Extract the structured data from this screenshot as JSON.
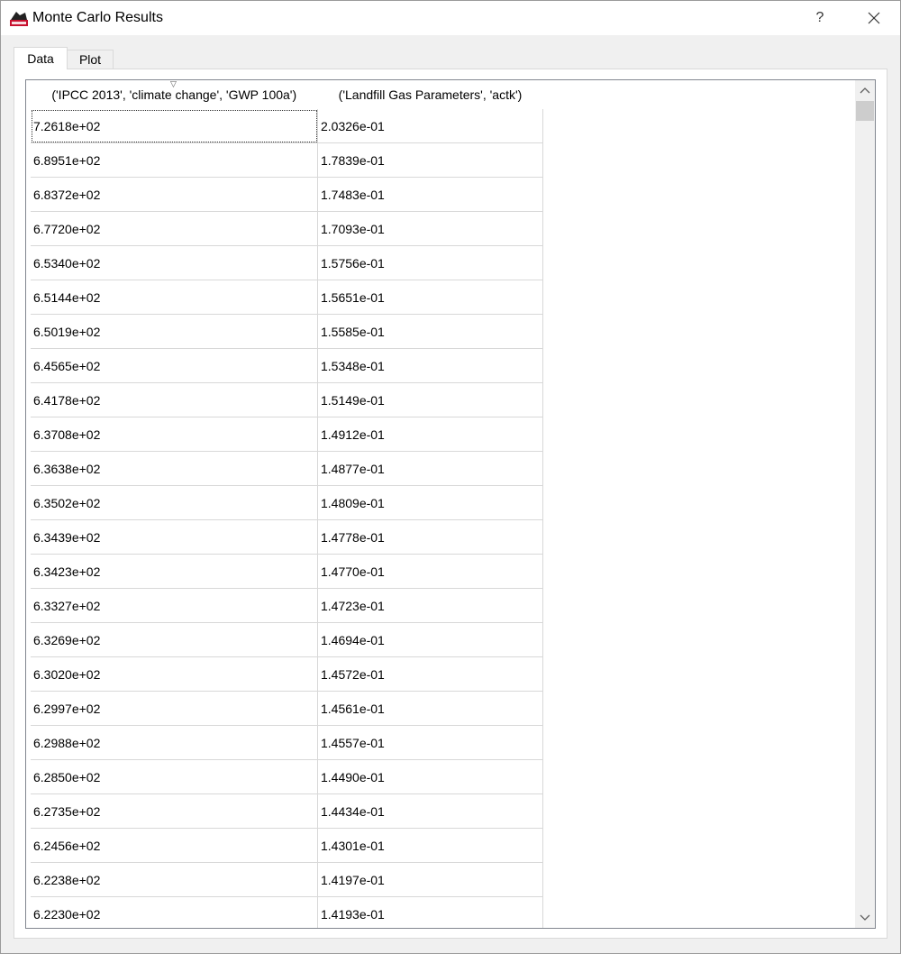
{
  "window": {
    "title": "Monte Carlo Results",
    "help_label": "?",
    "close_label": "✕",
    "icon": "app-logo-icon"
  },
  "tabs": [
    {
      "label": "Data",
      "selected": true
    },
    {
      "label": "Plot",
      "selected": false
    }
  ],
  "table": {
    "columns": [
      "('IPCC 2013', 'climate change', 'GWP 100a')",
      "('Landfill Gas Parameters', 'actk')"
    ],
    "sort_indicator": "▽",
    "rows": [
      [
        "7.2618e+02",
        "2.0326e-01"
      ],
      [
        "6.8951e+02",
        "1.7839e-01"
      ],
      [
        "6.8372e+02",
        "1.7483e-01"
      ],
      [
        "6.7720e+02",
        "1.7093e-01"
      ],
      [
        "6.5340e+02",
        "1.5756e-01"
      ],
      [
        "6.5144e+02",
        "1.5651e-01"
      ],
      [
        "6.5019e+02",
        "1.5585e-01"
      ],
      [
        "6.4565e+02",
        "1.5348e-01"
      ],
      [
        "6.4178e+02",
        "1.5149e-01"
      ],
      [
        "6.3708e+02",
        "1.4912e-01"
      ],
      [
        "6.3638e+02",
        "1.4877e-01"
      ],
      [
        "6.3502e+02",
        "1.4809e-01"
      ],
      [
        "6.3439e+02",
        "1.4778e-01"
      ],
      [
        "6.3423e+02",
        "1.4770e-01"
      ],
      [
        "6.3327e+02",
        "1.4723e-01"
      ],
      [
        "6.3269e+02",
        "1.4694e-01"
      ],
      [
        "6.3020e+02",
        "1.4572e-01"
      ],
      [
        "6.2997e+02",
        "1.4561e-01"
      ],
      [
        "6.2988e+02",
        "1.4557e-01"
      ],
      [
        "6.2850e+02",
        "1.4490e-01"
      ],
      [
        "6.2735e+02",
        "1.4434e-01"
      ],
      [
        "6.2456e+02",
        "1.4301e-01"
      ],
      [
        "6.2238e+02",
        "1.4197e-01"
      ],
      [
        "6.2230e+02",
        "1.4193e-01"
      ]
    ]
  },
  "scrollbar": {
    "up_icon": "chevron-up-icon",
    "down_icon": "chevron-down-icon",
    "up_glyph": "︿",
    "down_glyph": "﹀"
  }
}
